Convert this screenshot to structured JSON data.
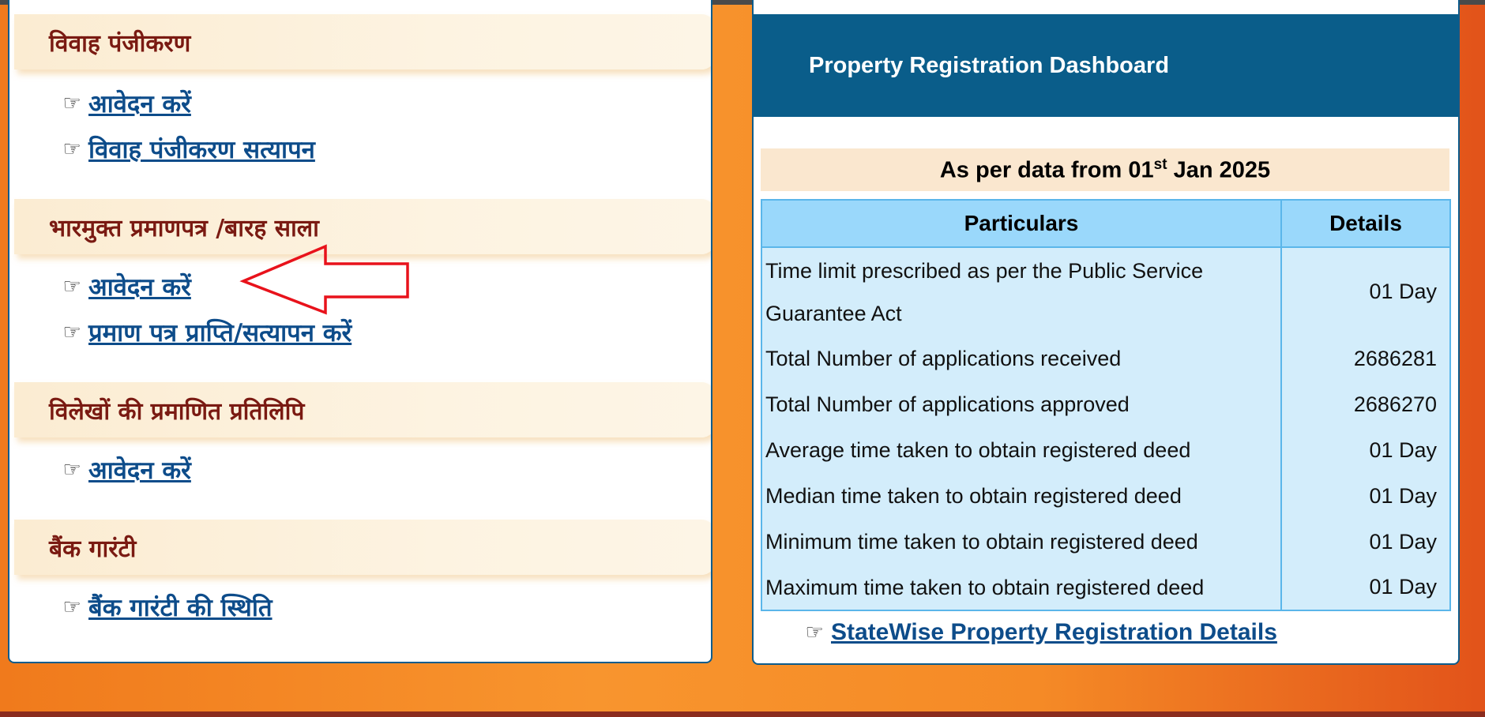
{
  "left": {
    "sections": [
      {
        "title": "विवाह पंजीकरण",
        "links": [
          "आवेदन करें",
          "विवाह पंजीकरण सत्यापन"
        ]
      },
      {
        "title": "भारमुक्त प्रमाणपत्र /बारह साला",
        "links": [
          "आवेदन करें",
          "प्रमाण पत्र प्राप्ति/सत्यापन करें"
        ]
      },
      {
        "title": "विलेखों की प्रमाणित प्रतिलिपि",
        "links": [
          "आवेदन करें"
        ]
      },
      {
        "title": "बैंक गारंटी",
        "links": [
          "बैंक गारंटी की स्थिति"
        ]
      }
    ]
  },
  "annotation": {
    "arrow_color": "#e8121b"
  },
  "dashboard": {
    "title": "Property Registration Dashboard",
    "date_prefix": "As per data from 01",
    "date_sup": "st",
    "date_suffix": " Jan 2025",
    "columns": [
      "Particulars",
      "Details"
    ],
    "rows": [
      {
        "particular": "Time limit prescribed as per the Public Service Guarantee Act",
        "detail": "01 Day"
      },
      {
        "particular": "Total Number of applications received",
        "detail": "2686281"
      },
      {
        "particular": "Total Number of applications approved",
        "detail": "2686270"
      },
      {
        "particular": "Average time taken to obtain registered deed",
        "detail": "01 Day"
      },
      {
        "particular": "Median time taken to obtain registered deed",
        "detail": "01 Day"
      },
      {
        "particular": "Minimum time taken to obtain registered deed",
        "detail": "01 Day"
      },
      {
        "particular": "Maximum time taken to obtain registered deed",
        "detail": "01 Day"
      }
    ],
    "statewise_link": "StateWise Property Registration Details"
  },
  "icons": {
    "link_icon": "pointing-hand-icon"
  },
  "colors": {
    "header_blue": "#0a5d8a",
    "link_blue": "#0d4c8a",
    "section_title": "#7a1a12",
    "table_bg": "#d3edfb",
    "table_head": "#9ad8fb"
  }
}
